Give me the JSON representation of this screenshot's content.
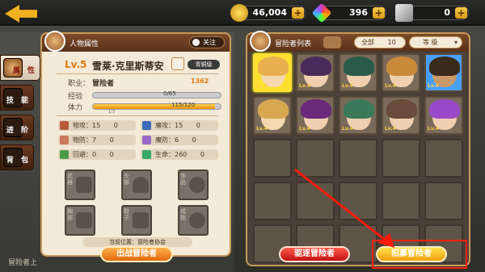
{
  "currency": {
    "gold": "46,004",
    "gems": "396",
    "tickets": "0"
  },
  "tabs": [
    {
      "label": "属 性",
      "active": true
    },
    {
      "label": "技 能",
      "active": false
    },
    {
      "label": "进 阶",
      "active": false
    },
    {
      "label": "背 包",
      "active": false
    }
  ],
  "attributes_panel": {
    "title": "人物属性",
    "follow_label": "关注",
    "level": "Lv.5",
    "hero_name": "雪莱·克里斯蒂安",
    "grade": "青铜级",
    "power": "1362",
    "job_label": "职业：",
    "job": "冒险者",
    "exp_label": "经验",
    "exp_value": "0/65",
    "exp_fraction": 0.0,
    "stamina_label": "体力",
    "stamina_value": "115/120",
    "stamina_fraction": 0.958,
    "stamina_sub": "1/3",
    "stats": [
      {
        "label": "物攻：",
        "value": "15",
        "extra": "0"
      },
      {
        "label": "魔攻：",
        "value": "15",
        "extra": "0"
      },
      {
        "label": "物防：",
        "value": "7",
        "extra": "0"
      },
      {
        "label": "魔防：",
        "value": "6",
        "extra": "0"
      },
      {
        "label": "回避：",
        "value": "0",
        "extra": "0"
      },
      {
        "label": "生命：",
        "value": "260",
        "extra": "0"
      }
    ],
    "equipment_labels": [
      "武器",
      "头部",
      "饰品",
      "胸部",
      "鞋子",
      "戒指"
    ],
    "location_label": "当前位置：",
    "location": "冒险者协会",
    "action_button": "出战冒险者"
  },
  "roster_panel": {
    "title": "冒险者列表",
    "filter_all": "全部",
    "count": "10",
    "sort": "等 级",
    "level_tag": "Lv.4",
    "dismiss_button": "驱逐冒险者",
    "recruit_button": "招募冒险者"
  },
  "bottom_left_text": "冒险者上"
}
